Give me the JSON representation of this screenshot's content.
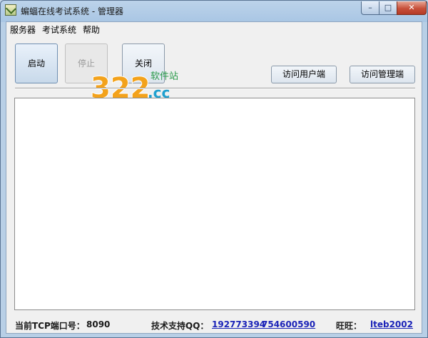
{
  "window": {
    "title": "蝙蝠在线考试系统 - 管理器"
  },
  "controls": {
    "minimize": "–",
    "maximize": "□",
    "close": "✕"
  },
  "menu": [
    "服务器",
    "考试系统",
    "帮助"
  ],
  "toolbar": {
    "start": "启动",
    "stop": "停止",
    "close": "关闭",
    "visit_user": "访问用户端",
    "visit_admin": "访问管理端"
  },
  "watermark": {
    "number": "322",
    "domain": ".cc",
    "site": "软件站"
  },
  "statusbar": {
    "port_label": "当前TCP端口号：",
    "port_value": "8090",
    "support_label": "技术支持QQ：",
    "qq1": "192773394",
    "qq2": "754600590",
    "wangwang_label": "旺旺：",
    "wangwang_value": "lteb2002"
  }
}
